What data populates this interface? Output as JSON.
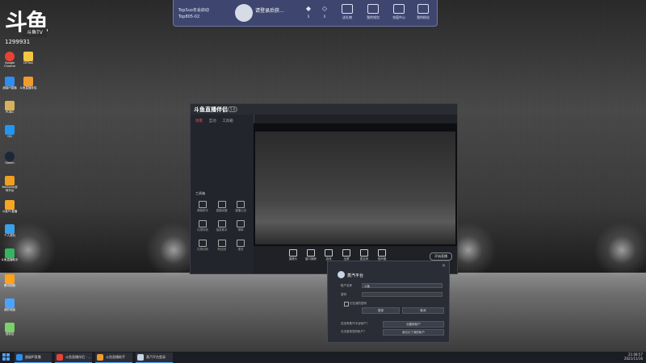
{
  "banner": {
    "line1": "TopSuo年会启动",
    "line2": "Top805-02",
    "login_title": "请登录后获...",
    "login_sub": "点击登录 ▸",
    "counts": [
      "0",
      "0"
    ],
    "buttons": [
      "送礼物",
      "我的钱包",
      "充值中心",
      "我的粉丝"
    ]
  },
  "logo": {
    "badge": "斗鱼TV",
    "number": "1299931"
  },
  "desktop_icons": [
    {
      "label": "Google Chrome",
      "color": "#e94235"
    },
    {
      "label": "DYTool",
      "color": "#f4c542"
    },
    {
      "label": "超级IP直播",
      "color": "#2e8ef0"
    },
    {
      "label": "斗鱼直播伴侣",
      "color": "#f39a2c"
    },
    {
      "label": "PUBG",
      "color": "#d8b25a"
    },
    {
      "label": "QQ",
      "color": "#2196f3"
    },
    {
      "label": "Steam",
      "color": "#1b2838"
    },
    {
      "label": "WeGame游戏平台",
      "color": "#f0a020"
    },
    {
      "label": "斗鱼PC直播",
      "color": "#f5a623"
    },
    {
      "label": "个人资料",
      "color": "#3aa0e8"
    },
    {
      "label": "斗鱼直播助手",
      "color": "#35b460"
    },
    {
      "label": "腾讯视频",
      "color": "#ffa21a"
    },
    {
      "label": "我的电脑",
      "color": "#4aa3ff"
    },
    {
      "label": "回收站",
      "color": "#7ccf6b"
    }
  ],
  "app": {
    "brand": "斗鱼直播伴侣",
    "version": "5.0",
    "tabs": [
      "场景",
      "互动",
      "工具箱"
    ],
    "grid_title": "工具箱",
    "grid": [
      "弹幕助手",
      "直播设置",
      "直播公告",
      "礼物特效",
      "抽奖助手",
      "榜单",
      "礼物动效",
      "粉丝团",
      "更多"
    ],
    "tools": [
      "摄像头",
      "窗口捕获",
      "游戏",
      "全屏",
      "麦克风",
      "扬声器"
    ],
    "start_label": "开始直播"
  },
  "dialog": {
    "title": "蒸汽平台",
    "account_label": "账户名称",
    "account_value": "斗鱼",
    "password_label": "密码",
    "remember_label": "记住我的密码",
    "login_button": "登录",
    "cancel_button": "取消",
    "no_account_label": "还没有蒸汽平台帐户？",
    "create_button": "创建新帐户",
    "forgot_label": "无法登录您的帐户？",
    "forgot_button": "我忘记了我的帐户"
  },
  "taskbar": {
    "tasks": [
      {
        "label": "超级IP直播",
        "color": "#2e8ef0"
      },
      {
        "label": "斗鱼直播伴侣 - ...",
        "color": "#e94235"
      },
      {
        "label": "斗鱼直播助手",
        "color": "#f39a2c"
      },
      {
        "label": "蒸汽平台登录",
        "color": "#c9d4e4"
      }
    ],
    "time": "21:08:57",
    "date": "2021/11/16"
  }
}
